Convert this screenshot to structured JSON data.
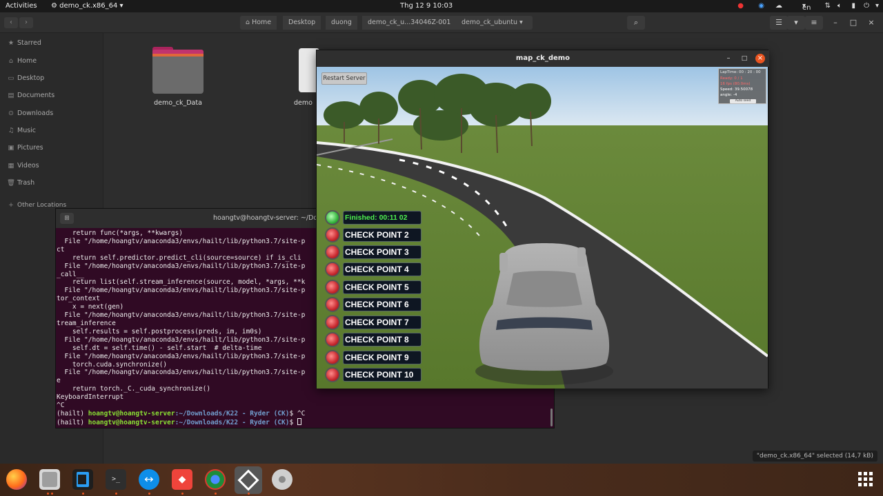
{
  "topbar": {
    "activities": "Activities",
    "app_name": "demo_ck.x86_64",
    "clock": "Thg 12 9  10:03",
    "lang": "en"
  },
  "files": {
    "breadcrumbs": [
      "Home",
      "Desktop",
      "duong",
      "demo_ck_u...34046Z-001",
      "demo_ck_ubuntu"
    ],
    "sidebar": [
      "Starred",
      "Home",
      "Desktop",
      "Documents",
      "Downloads",
      "Music",
      "Pictures",
      "Videos",
      "Trash"
    ],
    "other_locations": "Other Locations",
    "folders": [
      {
        "name": "demo_ck_Data"
      },
      {
        "name": "demo"
      }
    ],
    "status": "\"demo_ck.x86_64\" selected (14,7 kB)"
  },
  "terminal": {
    "title": "hoangtv@hoangtv-server: ~/Do",
    "lines": [
      "    return func(*args, **kwargs)",
      "  File \"/home/hoangtv/anaconda3/envs/hailt/lib/python3.7/site-p",
      "ct",
      "    return self.predictor.predict_cli(source=source) if is_cli",
      "  File \"/home/hoangtv/anaconda3/envs/hailt/lib/python3.7/site-p",
      "_call__",
      "    return list(self.stream_inference(source, model, *args, **k",
      "  File \"/home/hoangtv/anaconda3/envs/hailt/lib/python3.7/site-p",
      "tor_context",
      "    x = next(gen)",
      "  File \"/home/hoangtv/anaconda3/envs/hailt/lib/python3.7/site-p",
      "tream_inference",
      "    self.results = self.postprocess(preds, im, im0s)",
      "  File \"/home/hoangtv/anaconda3/envs/hailt/lib/python3.7/site-p",
      "    self.dt = self.time() - self.start  # delta-time",
      "  File \"/home/hoangtv/anaconda3/envs/hailt/lib/python3.7/site-p",
      "    torch.cuda.synchronize()",
      "  File \"/home/hoangtv/anaconda3/envs/hailt/lib/python3.7/site-p",
      "e",
      "    return torch._C._cuda_synchronize()",
      "KeyboardInterrupt",
      "^C"
    ],
    "prompt_env": "(hailt) ",
    "prompt_user": "hoangtv@hoangtv-server",
    "prompt_path": ":~/Downloads/K22 - Ryder (CK)",
    "prompt_dollar": "$ ",
    "prompt1_cmd": "^C"
  },
  "game": {
    "title": "map_ck_demo",
    "restart_label": "Restart Server",
    "hud": {
      "lap_time": "LapTime:  00 : 20 : 00",
      "row2": "Ready: 0 / 1",
      "row3": "16 fps (80.0ms)",
      "speed": "Speed: 39.50078",
      "angle": "angle: -4",
      "button": "Auto seed"
    },
    "finished": "Finished:  00:11  02",
    "checkpoints": [
      "CHECK POINT 2",
      "CHECK POINT 3",
      "CHECK POINT 4",
      "CHECK POINT 5",
      "CHECK POINT 6",
      "CHECK POINT 7",
      "CHECK POINT 8",
      "CHECK POINT 9",
      "CHECK POINT 10"
    ]
  },
  "dock": {
    "apps": [
      "firefox-icon",
      "files-icon",
      "vscode-icon",
      "terminal-icon",
      "teamviewer-icon",
      "anydesk-icon",
      "chrome-icon",
      "unity-icon",
      "disk-icon"
    ]
  }
}
